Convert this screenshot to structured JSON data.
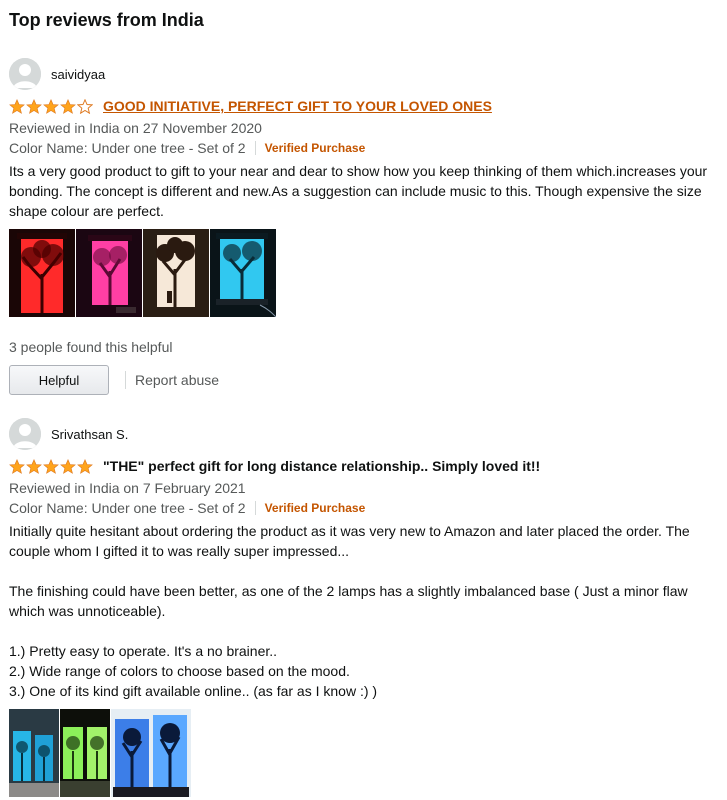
{
  "section_title": "Top reviews from India",
  "colors": {
    "star": "#ffa41c",
    "link": "#c45500",
    "secondary_text": "#565959"
  },
  "reviews": [
    {
      "profile_name": "saividyaa",
      "rating": 4,
      "title": " GOOD INITIATIVE, PERFECT GIFT TO YOUR LOVED ONES",
      "reviewed_line": "Reviewed in India on 27 November 2020",
      "variant": "Color Name: Under one tree - Set of 2",
      "verified": "Verified Purchase",
      "body": [
        "Its a very good product to gift to your near and dear to show how you keep thinking of them which.increases your bonding. The concept is different and new.As a suggestion can include music to this. Though expensive the size shape colour are perfect."
      ],
      "images": [
        "red lamp",
        "pink lamp",
        "white lamp",
        "blue lamp"
      ],
      "helpful_count_text": "3 people found this helpful",
      "helpful_button": "Helpful",
      "report_abuse": "Report abuse"
    },
    {
      "profile_name": "Srivathsan S.",
      "rating": 5,
      "title": "\"THE\" perfect gift for long distance relationship.. Simply loved it!!",
      "reviewed_line": "Reviewed in India on 7 February 2021",
      "variant": "Color Name: Under one tree - Set of 2",
      "verified": "Verified Purchase",
      "body": [
        "Initially quite hesitant about ordering the product as it was very new to Amazon and later placed the order. The couple whom I gifted it to was really super impressed...",
        "The finishing could have been better, as one of the 2 lamps has a slightly imbalanced base ( Just a minor flaw which was unnoticeable).",
        "1.) Pretty easy to operate. It's a no brainer..",
        "2.) Wide range of colors to choose based on the mood.",
        "3.) One of its kind gift available online.. (as far as I know :) )"
      ],
      "images": [
        "blue lamps",
        "green lamps",
        "blue lamp pair"
      ]
    }
  ]
}
